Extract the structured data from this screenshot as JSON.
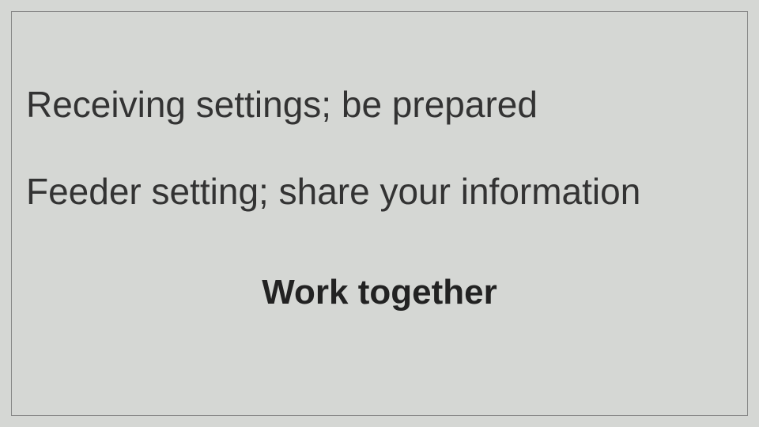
{
  "slide": {
    "line1": "Receiving settings;  be prepared",
    "line2": "Feeder setting; share your information",
    "line3": "Work together"
  }
}
